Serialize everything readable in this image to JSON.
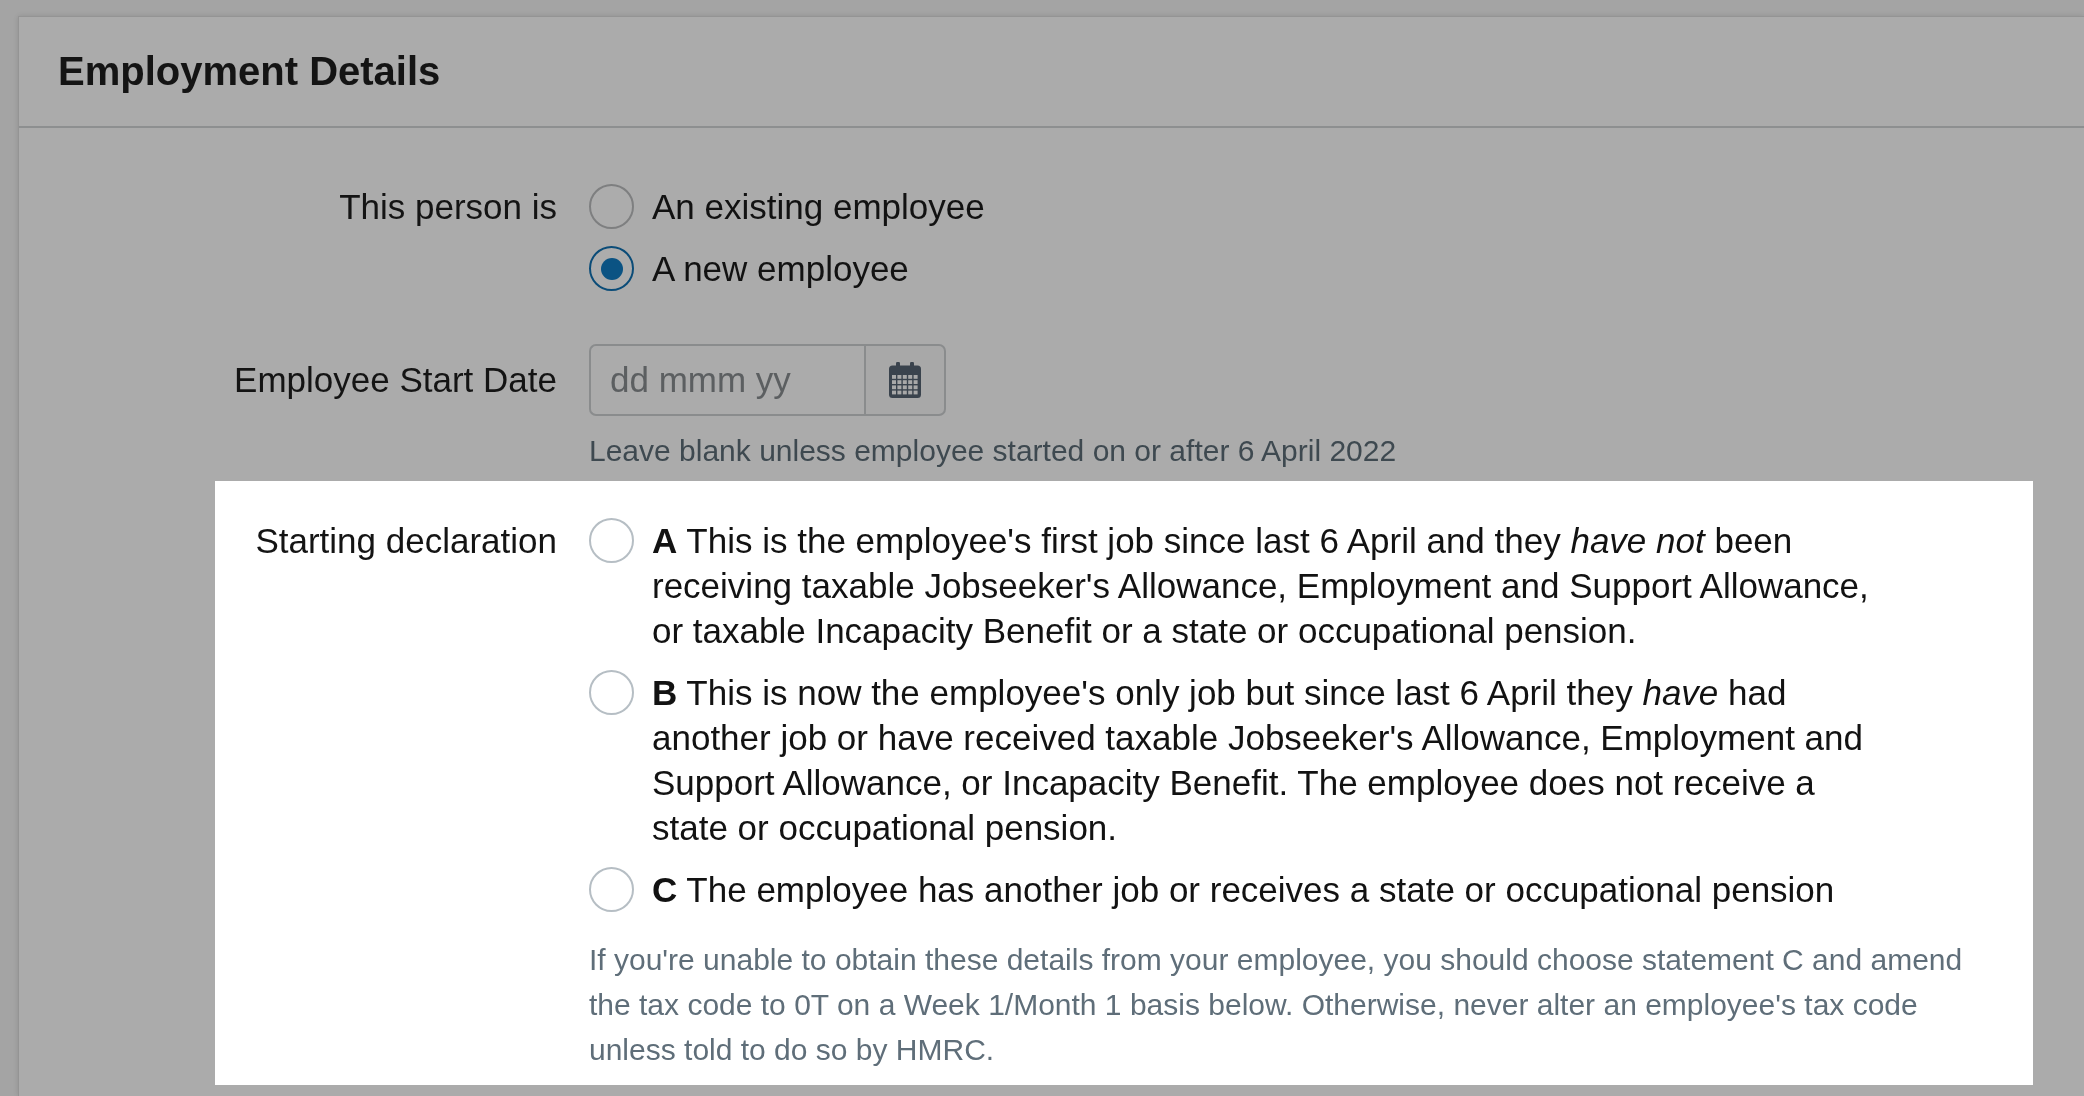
{
  "panel": {
    "title": "Employment Details"
  },
  "fields": [
    {
      "kind": "radio_group",
      "label": "This person is",
      "highlighted": false,
      "options": [
        {
          "text": "An existing employee",
          "selected": false
        },
        {
          "text": "A new employee",
          "selected": true
        }
      ]
    },
    {
      "kind": "date",
      "label": "Employee Start Date",
      "highlighted": false,
      "placeholder": "dd mmm yy",
      "hint": "Leave blank unless employee started on or after 6 April 2022"
    },
    {
      "kind": "radio_group",
      "label": "Starting declaration",
      "highlighted": true,
      "options": [
        {
          "text": "**A** This is the employee's first job since last 6 April and they *have not* been receiving taxable Jobseeker's Allowance, Employment and Support Allowance, or taxable Incapacity Benefit or a state or occupational pension.",
          "selected": false
        },
        {
          "text": "**B** This is now the employee's only job but since last 6 April they *have* had another job or have received taxable Jobseeker's Allowance, Employment and Support Allowance, or Incapacity Benefit. The employee does not receive a state or occupational pension.",
          "selected": false
        },
        {
          "text": "**C** The employee has another job or receives a state or occupational pension",
          "selected": false
        }
      ],
      "hint": "If you're unable to obtain these details from your employee, you should choose statement C and amend the tax code to 0T on a Week 1/Month 1 basis below. Otherwise, never alter an employee's tax code unless told to do so by HMRC."
    }
  ]
}
